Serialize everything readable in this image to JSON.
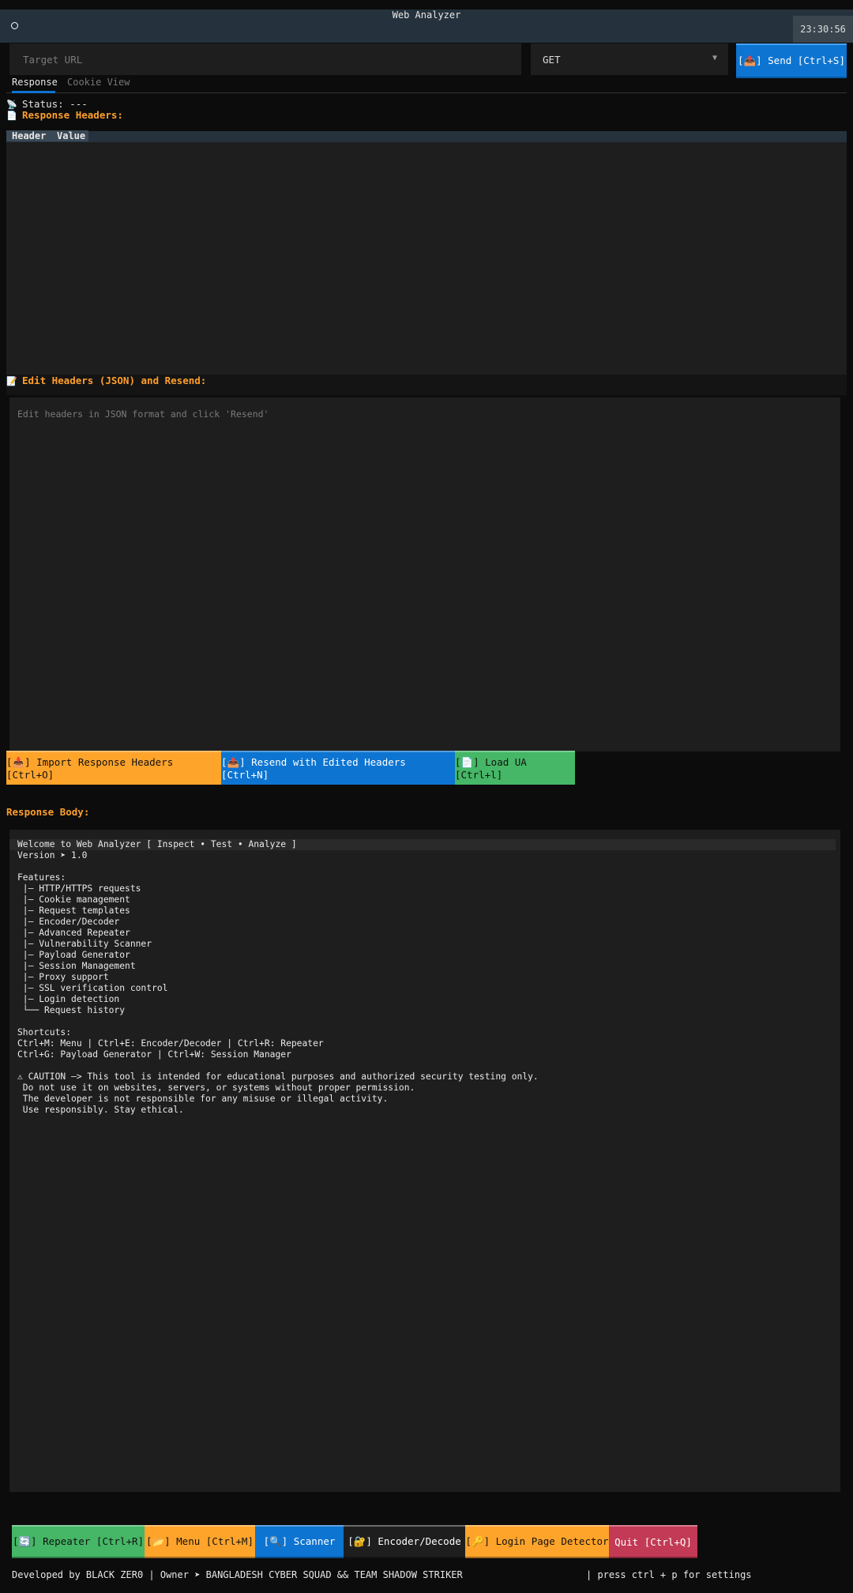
{
  "header": {
    "title": "Web Analyzer",
    "clock": "23:30:56"
  },
  "request": {
    "url_placeholder": "Target URL",
    "url_value": "",
    "method": "GET",
    "send_label": "[📤] Send [Ctrl+S]"
  },
  "tabs": [
    {
      "label": "Response",
      "active": true
    },
    {
      "label": "Cookie View",
      "active": false
    }
  ],
  "response": {
    "status_label": "Status: ---",
    "headers_label": "Response Headers:",
    "table_columns": [
      "Header",
      "Value"
    ],
    "edit_label": "Edit Headers (JSON) and Resend:",
    "edit_placeholder": "Edit headers in JSON format and click 'Resend'",
    "body_label": "Response Body:"
  },
  "actions": {
    "import_label": "[📥] Import Response Headers [Ctrl+O]",
    "resend_label": "[📤] Resend with Edited Headers [Ctrl+N]",
    "load_ua_label": "[📄] Load UA [Ctrl+l]"
  },
  "body_text": "Welcome to Web Analyzer [ Inspect • Test • Analyze ]\nVersion ➤ 1.0\n\nFeatures:\n |— HTTP/HTTPS requests\n |— Cookie management\n |— Request templates\n |— Encoder/Decoder\n |— Advanced Repeater\n |— Vulnerability Scanner\n |— Payload Generator\n |— Session Management\n |— Proxy support\n |— SSL verification control\n |— Login detection\n └── Request history\n\nShortcuts:\nCtrl+M: Menu | Ctrl+E: Encoder/Decoder | Ctrl+R: Repeater\nCtrl+G: Payload Generator | Ctrl+W: Session Manager\n\n⚠ CAUTION —> This tool is intended for educational purposes and authorized security testing only.\n Do not use it on websites, servers, or systems without proper permission.\n The developer is not responsible for any misuse or illegal activity.\n Use responsibly. Stay ethical.",
  "nav": {
    "repeater": "[🔄] Repeater [Ctrl+R]",
    "menu": "[📂] Menu [Ctrl+M]",
    "scanner": "[🔍] Scanner",
    "encoder": "[🔐] Encoder/Decode",
    "login_detector": "[🔑] Login Page Detector",
    "quit": "Quit [Ctrl+Q]"
  },
  "footer": {
    "credits": "Developed by BLACK ZER0 | Owner ➤ BANGLADESH CYBER SQUAD && TEAM SHADOW STRIKER",
    "hint": "| press ctrl + p for settings"
  },
  "colors": {
    "accent_blue": "#0d74d1",
    "accent_orange": "#ffa42b",
    "accent_green": "#45b766",
    "quit_red": "#c23a55",
    "header_bar": "#25323d"
  }
}
